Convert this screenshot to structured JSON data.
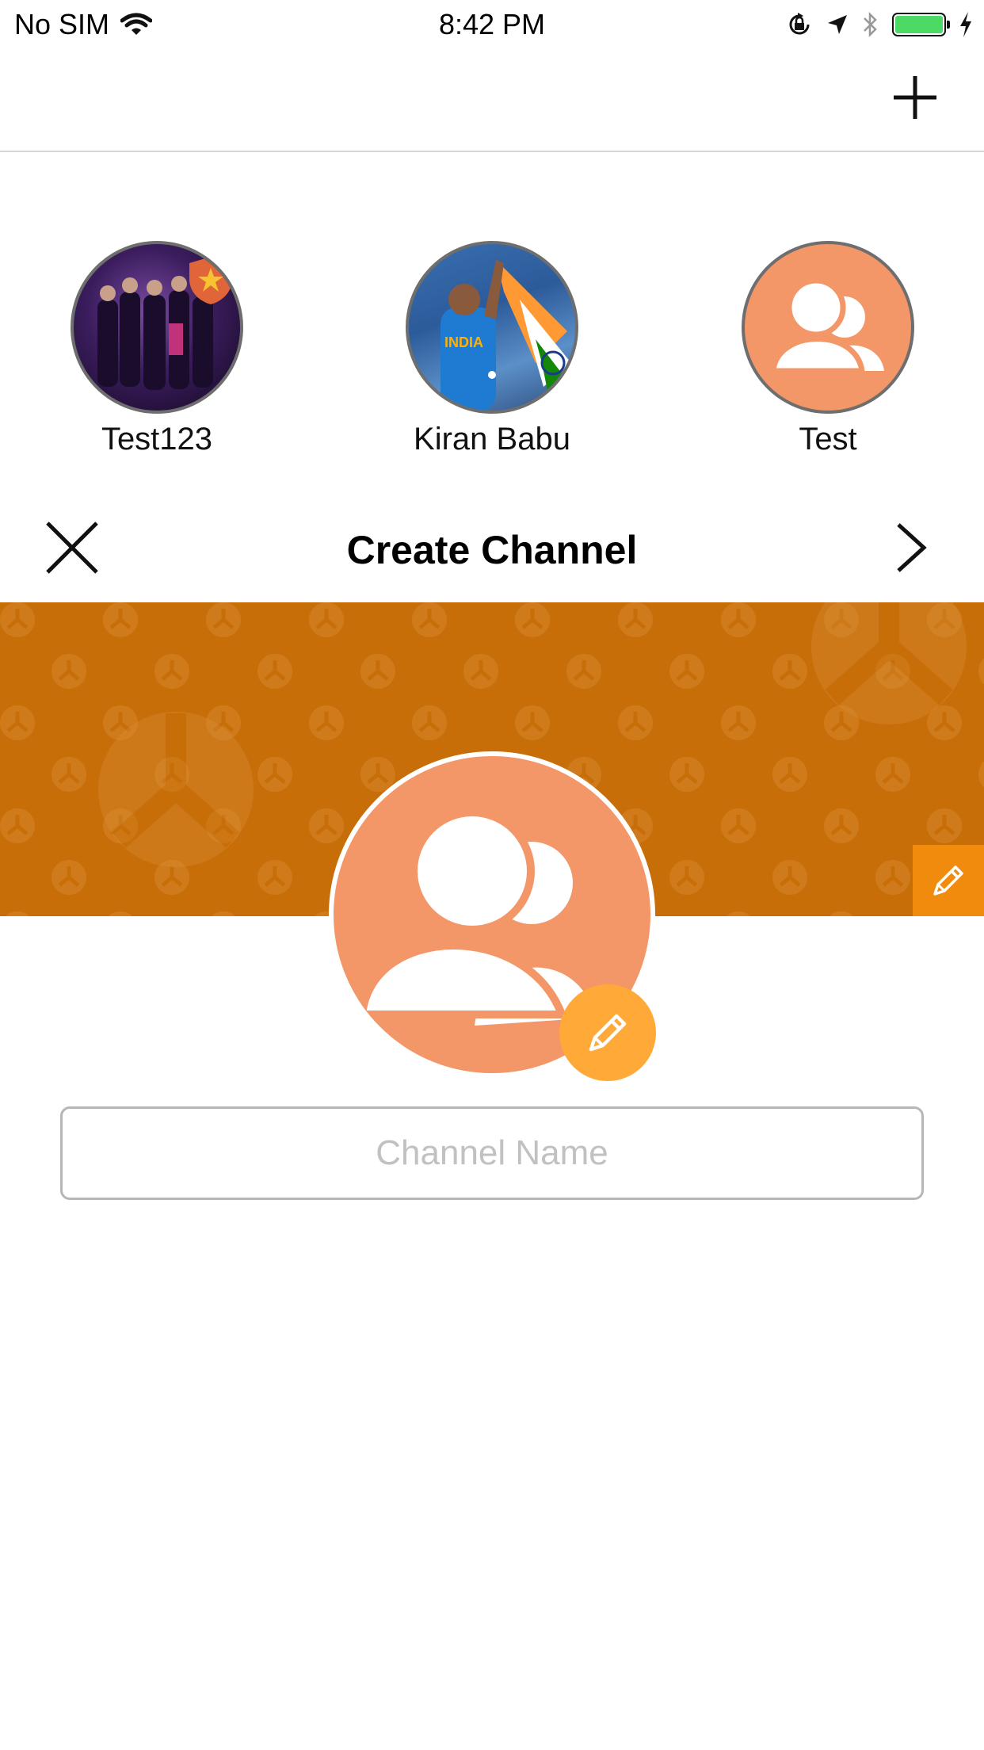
{
  "status_bar": {
    "carrier": "No SIM",
    "time": "8:42 PM",
    "battery_color": "#4cd964"
  },
  "nav": {
    "add_icon": "plus-icon"
  },
  "channels": [
    {
      "label": "Test123",
      "avatar": "group-photo",
      "badge": "shield-star-icon"
    },
    {
      "label": "Kiran Babu",
      "avatar": "cricket-photo"
    },
    {
      "label": "Test",
      "avatar": "people-icon"
    }
  ],
  "header": {
    "title": "Create Channel",
    "close_icon": "close-icon",
    "next_icon": "chevron-right-icon"
  },
  "banner": {
    "color": "#c86e09",
    "edit_icon": "pencil-icon",
    "edit_color": "#f18b0e"
  },
  "avatar": {
    "color": "#f39668",
    "edit_color": "#ffa938"
  },
  "form": {
    "channel_name_placeholder": "Channel Name",
    "channel_name_value": ""
  }
}
